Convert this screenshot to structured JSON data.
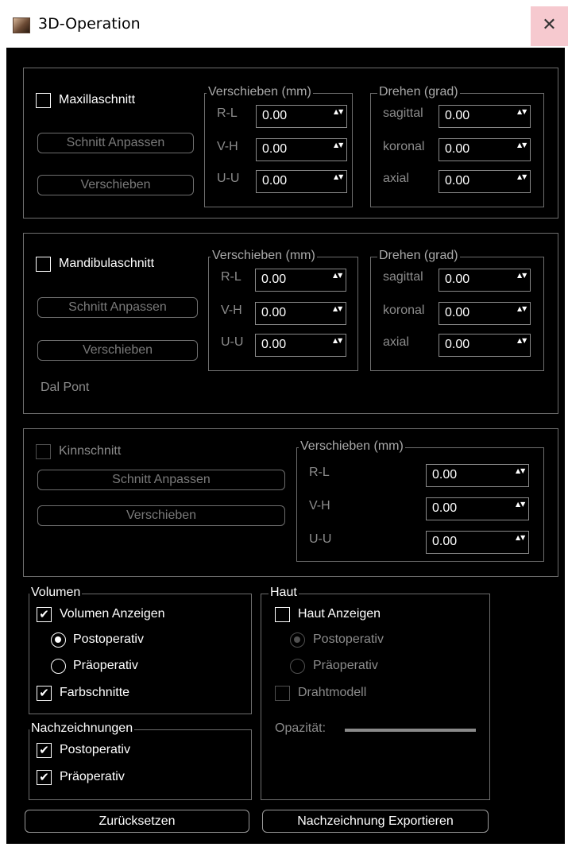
{
  "window": {
    "title": "3D-Operation",
    "close_glyph": "✕",
    "icon": "app-skull-icon"
  },
  "maxilla": {
    "checkbox_label": "Maxillaschnitt",
    "checked": false,
    "buttons": {
      "adjust": "Schnitt Anpassen",
      "move": "Verschieben"
    },
    "move_group": {
      "title": "Verschieben (mm)",
      "rows": [
        {
          "label": "R-L",
          "value": "0.00"
        },
        {
          "label": "V-H",
          "value": "0.00"
        },
        {
          "label": "U-U",
          "value": "0.00"
        }
      ]
    },
    "rotate_group": {
      "title": "Drehen (grad)",
      "rows": [
        {
          "label": "sagittal",
          "value": "0.00"
        },
        {
          "label": "koronal",
          "value": "0.00"
        },
        {
          "label": "axial",
          "value": "0.00"
        }
      ]
    }
  },
  "mandibula": {
    "checkbox_label": "Mandibulaschnitt",
    "checked": false,
    "buttons": {
      "adjust": "Schnitt Anpassen",
      "move": "Verschieben"
    },
    "extra_label": "Dal Pont",
    "move_group": {
      "title": "Verschieben (mm)",
      "rows": [
        {
          "label": "R-L",
          "value": "0.00"
        },
        {
          "label": "V-H",
          "value": "0.00"
        },
        {
          "label": "U-U",
          "value": "0.00"
        }
      ]
    },
    "rotate_group": {
      "title": "Drehen (grad)",
      "rows": [
        {
          "label": "sagittal",
          "value": "0.00"
        },
        {
          "label": "koronal",
          "value": "0.00"
        },
        {
          "label": "axial",
          "value": "0.00"
        }
      ]
    }
  },
  "kinn": {
    "checkbox_label": "Kinnschnitt",
    "checked": false,
    "buttons": {
      "adjust": "Schnitt Anpassen",
      "move": "Verschieben"
    },
    "move_group": {
      "title": "Verschieben (mm)",
      "rows": [
        {
          "label": "R-L",
          "value": "0.00"
        },
        {
          "label": "V-H",
          "value": "0.00"
        },
        {
          "label": "U-U",
          "value": "0.00"
        }
      ]
    }
  },
  "volumen": {
    "title": "Volumen",
    "show_label": "Volumen Anzeigen",
    "show_checked": true,
    "post_label": "Postoperativ",
    "post_selected": true,
    "pre_label": "Präoperativ",
    "pre_selected": false,
    "color_label": "Farbschnitte",
    "color_checked": true
  },
  "nachzeichnungen": {
    "title": "Nachzeichnungen",
    "post_label": "Postoperativ",
    "post_checked": true,
    "pre_label": "Präoperativ",
    "pre_checked": true
  },
  "haut": {
    "title": "Haut",
    "show_label": "Haut Anzeigen",
    "show_checked": false,
    "post_label": "Postoperativ",
    "post_selected": true,
    "pre_label": "Präoperativ",
    "pre_selected": false,
    "wire_label": "Drahtmodell",
    "wire_checked": false,
    "opacity_label": "Opazität:"
  },
  "footer": {
    "reset_label": "Zurücksetzen",
    "export_label": "Nachzeichnung Exportieren"
  },
  "check_glyph": "✔",
  "spin_glyph": "▲▼"
}
